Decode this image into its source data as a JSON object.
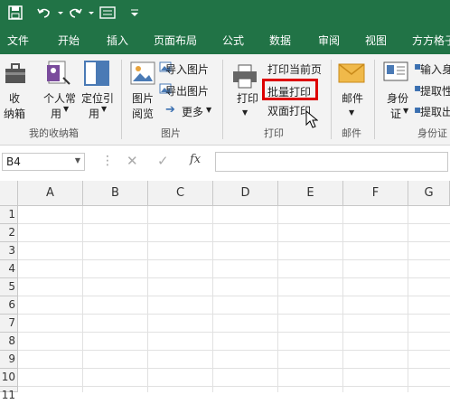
{
  "tabs": [
    "文件",
    "开始",
    "插入",
    "页面布局",
    "公式",
    "数据",
    "审阅",
    "视图",
    "方方格子"
  ],
  "ribbon": {
    "favorites_btn": "收纳箱",
    "favorites_btn_line1": "收",
    "favorites_btn_line2": "纳箱",
    "personal_line1": "个人常",
    "personal_line2": "用",
    "locate_line1": "定位引",
    "locate_line2": "用",
    "group_favorites": "我的收纳箱",
    "image_browse_line1": "图片",
    "image_browse_line2": "阅览",
    "import_image": "导入图片",
    "export_image": "导出图片",
    "more": "更多",
    "group_images": "图片",
    "print_label": "打印",
    "print_current": "打印当前页",
    "batch_print": "批量打印",
    "duplex_print": "双面打印",
    "group_print": "打印",
    "mail_label": "邮件",
    "group_mail": "邮件",
    "id_line1": "身份",
    "id_line2": "证",
    "id_input": "输入身",
    "id_extract1": "提取性",
    "id_extract2": "提取出",
    "group_id": "身份证"
  },
  "formula": {
    "cell_ref": "B4",
    "fx_label": "fx",
    "value": ""
  },
  "columns": [
    "A",
    "B",
    "C",
    "D",
    "E",
    "F",
    "G"
  ],
  "rows": [
    "1",
    "2",
    "3",
    "4",
    "5",
    "6",
    "7",
    "8",
    "9",
    "10",
    "11"
  ],
  "colors": {
    "accent": "#217346",
    "highlight": "#dd0000"
  }
}
